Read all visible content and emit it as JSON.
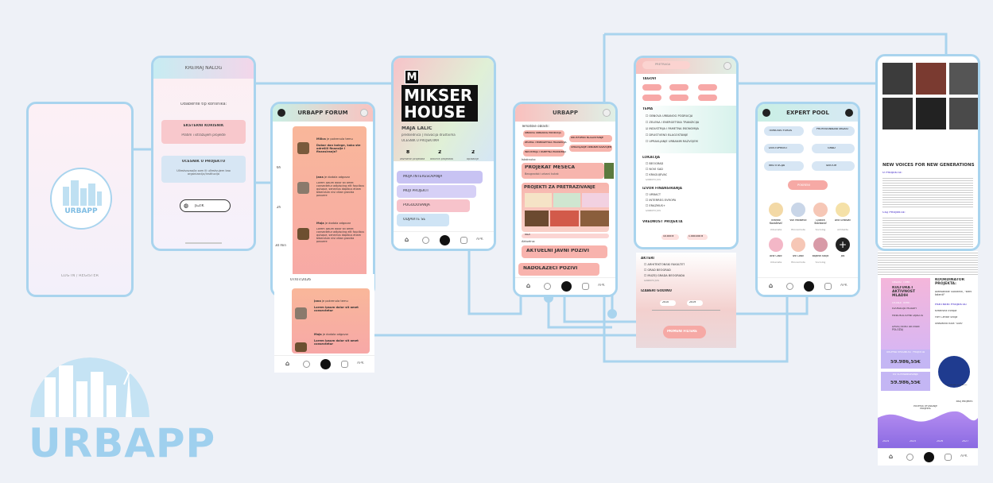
{
  "logo": {
    "wordmark": "URBAPP"
  },
  "colors": {
    "phone_border": "#a9d4ee",
    "connector": "#a9d4ee",
    "grad_pink": "#f6a9a5",
    "grad_mint": "#c9efe4",
    "grad_lilac": "#b9a9f2"
  },
  "splash": {
    "app_name": "URBAPP",
    "login": "LOG IN / REGISTER"
  },
  "register": {
    "title": "KREIRAJ NALOG",
    "subtitle": "Odaberite tip korisnika:",
    "external_title": "EKSTERNI KORISNIK",
    "external_desc": "Pratim i istražujem projekte",
    "participant_title": "UČESNIK U PROJEKTU",
    "participant_desc": "Učestvovao/la sam ili učestvujem kao organizacija/institucija",
    "language": "JEZIK"
  },
  "forum": {
    "title": "URBAPP FORUM",
    "times": [
      "6h",
      "2h",
      "30 min"
    ],
    "posts": [
      {
        "author": "Milica",
        "action": "je pokrenula temu",
        "body": "Dobar dan kolege, kako ste odrešili finansije i finansiranje?"
      },
      {
        "author": "Jana",
        "action": "je dodala odgovor",
        "body": "Lorem ipsum dolor sit amet consectetur adipiscing elit faucibus quisque, senectus dapibus etiam bibendum nisi vitae gravida posuere"
      },
      {
        "author": "Maja",
        "action": "je dodala odgovor",
        "body": "Lorem ipsum dolor sit amet consectetur adipiscing elit faucibus quisque, senectus dapibus etiam bibendum nisi vitae gravida posuere"
      }
    ],
    "more": "PROČITAJ ŠIRE",
    "date": "07/07/2026",
    "posts2": [
      {
        "author": "Jana",
        "action": "je pokrenula temu",
        "body": "Lorem ipsum dolor sit amet consectetur"
      },
      {
        "author": "Maja",
        "action": "je dodala odgovor",
        "body": "Lorem ipsum dolor sit amet consectetur"
      }
    ],
    "nav_label": "APK"
  },
  "profile": {
    "badge": "M",
    "org_line1": "MIKSER",
    "org_line2": "HOUSE",
    "person": "MAJA LALIĆ",
    "role": "predsednica | Inovacija društvima",
    "status": "UČESNIK U PROJEKTIMA",
    "stats": [
      {
        "value": "8",
        "label": "završenih projekata"
      },
      {
        "value": "2",
        "label": "aktivnih projekata"
      },
      {
        "value": "2",
        "label": "aplikacije"
      }
    ],
    "menu": [
      "MOJA INTERESOVANJA",
      "MOJI PROJEKTI",
      "POGODOVANJA",
      "ODJAVITE SE"
    ],
    "nav_label": "APK"
  },
  "home": {
    "title": "URBAPP",
    "topics_label": "Tematske oblasti:",
    "topics": [
      "OBNOVA URBANOG PODRUČJA",
      "ZELENA I ENERGETSKA TRANZICIJA",
      "INDUSTRIJA I PAMETNA EKONOMIJA",
      "DRUŠTVENO BLAGOSTANJE",
      "UPRAVLJANJE URBANIM RAZVOJEM"
    ],
    "month_label": "Istaknuto:",
    "project_month": "PROJEKAT MESECA",
    "project_month_sub": "Beogradski urbani kutak",
    "explore": "PROJEKTI ZA PRETRAŽIVANJE",
    "view": "VIDI",
    "current_label": "Aktuelno:",
    "current_calls": "AKTUELNI JAVNI POZIVI",
    "upcoming_calls": "NADOLAZEĆI POZIVI",
    "nav_label": "APK"
  },
  "filters": {
    "search_placeholder": "PRETRAGA",
    "tags_title": "TAGOVI",
    "theme_title": "TEMA",
    "themes": [
      "OBNOVA URBANOG PODRUČJA",
      "ZELENA I ENERGETSKA TRANZICIJA",
      "INDUSTRIJA I PAMETNA EKONOMIJA",
      "DRUŠTVENO BLAGOSTANJE",
      "UPRAVLJANJE URBANIM RAZVOJEM"
    ],
    "location_title": "LOKACIJA",
    "locations": [
      "BEOGRAD",
      "NOVI SAD",
      "KRAGUJEVAC"
    ],
    "choose": "IZABERI JOŠ",
    "funding_title": "IZVOR FINANSIRANJA",
    "funding": [
      "URBACT",
      "INTERREG EVROPA",
      "ERAZMUS+"
    ],
    "value_title": "VREDNOST PROJEKTA",
    "value_min": "10.000 €",
    "value_max": "1.000.000 €",
    "actors_title": "AKTERI",
    "actors": [
      "ARHITEKTONSKI FAKULTET",
      "GRAD BEOGRAD",
      "MUZEJ GRADA BEOGRADA"
    ],
    "year_title": "IZABERI GODINU",
    "year_from": "2010",
    "year_to": "2019",
    "apply": "PRIMENI FILTERE"
  },
  "experts": {
    "title": "EXPERT POOL",
    "filters": [
      "TEMATSKI FOKUS",
      "PROFESIONALNA OBLAST",
      "DOSTUPNOST",
      "GRAD",
      "INSTITUCIJA",
      "SEKTOR"
    ],
    "search": "POKRENI",
    "people": [
      {
        "name": "Branko Kovačević",
        "role": "Urbanista"
      },
      {
        "name": "Vuk Mališević",
        "role": "Ekonomista"
      },
      {
        "name": "Ljubica Stanković",
        "role": "Sociolog"
      },
      {
        "name": "Ana Grkovac",
        "role": "Arhitekta"
      },
      {
        "name": "Ana Ćosić",
        "role": "Urbanista"
      },
      {
        "name": "Ivo Ćosić",
        "role": "Ekonomista"
      },
      {
        "name": "Bojana Stojić",
        "role": "Sociolog"
      }
    ],
    "add_label": "Još",
    "nav_label": "APK"
  },
  "project": {
    "title": "NEW VOICES FOR NEW GENERATIONS",
    "intro_label": "O PROJEKTU:",
    "goals_label": "CILJ PROJEKTA:",
    "area_label": "OBLAST TEME:",
    "area_title": "KULTURA I AKTIVNOST MLADIH",
    "other_label": "OSTALE TEME:",
    "other_topics": [
      "EDUKACIJA MLADIH",
      "MEĐUKULTURNI DIJALOG",
      "DRUŠTVENO AKTIVAN POLOŽAJ"
    ],
    "coordinator_label": "KOORDINATOR PROJEKTA:",
    "coordinator": "Aleksandar Subotnik, \"Bitni talenti\"",
    "partners_label": "PARTNERI PROJEKTA:",
    "partners": [
      "Kreativna Evropa",
      "Film Centar Srbija",
      "Izdavačka kuća \"Glas\""
    ],
    "total_label": "UKUPNA VREDNOST PROJEKTA",
    "total_value": "59.986,55€",
    "cofinance_label": "EU SUFINANSIRANJE",
    "cofinance_value": "59.986,55€",
    "eu_label": "Co-funded by the EU",
    "timeline_start": "POČETAK OTVARANJE PROJEKTA",
    "timeline_end": "KRAJ PROJEKTA",
    "years": [
      "2024",
      "2025",
      "2026",
      "2027"
    ],
    "nav_label": "APK"
  }
}
